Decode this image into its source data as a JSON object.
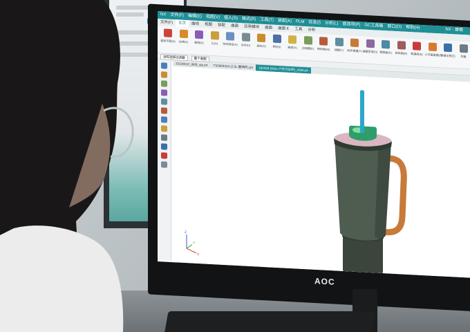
{
  "monitor": {
    "brand": "AOC"
  },
  "nx": {
    "titlebar": {
      "menu": [
        "NX",
        "文件(F)",
        "编辑(E)",
        "视图(V)",
        "插入(S)",
        "格式(R)",
        "工具(T)",
        "装配(A)",
        "PLM",
        "信息(I)",
        "分析(L)",
        "首选项(P)",
        "GC工具箱",
        "窗口(O)",
        "帮助(H)"
      ],
      "app_title": "NX - 建模"
    },
    "ribbon_tabs": [
      {
        "label": "文件(F)",
        "active": false
      },
      {
        "label": "主页",
        "active": true
      },
      {
        "label": "曲线",
        "active": false
      },
      {
        "label": "视图",
        "active": false
      },
      {
        "label": "装配",
        "active": false
      },
      {
        "label": "曲面",
        "active": false
      },
      {
        "label": "应用模块",
        "active": false
      },
      {
        "label": "曲面",
        "active": false
      },
      {
        "label": "曲面 E",
        "active": false
      },
      {
        "label": "工具",
        "active": false
      },
      {
        "label": "分析",
        "active": false
      }
    ],
    "ribbon_tools": [
      {
        "label": "基准平面(D)",
        "color": "#c9463b"
      },
      {
        "label": "拉伸(X)",
        "color": "#d98b2b"
      },
      {
        "label": "旋转(R)",
        "color": "#8a5cb8"
      },
      {
        "label": "孔(H)",
        "color": "#caa03a"
      },
      {
        "label": "阵列特征(A)",
        "color": "#6b8fc1"
      },
      {
        "label": "合并(U)",
        "color": "#7a8b95"
      },
      {
        "label": "减去(S)",
        "color": "#c98d2e"
      },
      {
        "label": "相交(I)",
        "color": "#4e6fa8"
      },
      {
        "label": "抽壳(H)",
        "color": "#d1b24a"
      },
      {
        "label": "边倒圆(E)",
        "color": "#7a9b5d"
      },
      {
        "label": "倒斜角(M)",
        "color": "#b85a3c"
      },
      {
        "label": "拔模(T)",
        "color": "#5e8e9e"
      },
      {
        "label": "同步建模(Y)",
        "color": "#c97a3a"
      },
      {
        "label": "偏置区域(O)",
        "color": "#8c6a9e"
      },
      {
        "label": "替换面(R)",
        "color": "#4d89a8"
      },
      {
        "label": "移除面(R)",
        "color": "#a05a5a"
      },
      {
        "label": "数据库(B)",
        "color": "#c93a3a"
      },
      {
        "label": "小平面建模(F)",
        "color": "#d97a2b"
      },
      {
        "label": "数据迁移(E)",
        "color": "#3a6fa8"
      },
      {
        "label": "测量",
        "color": "#6c7b84"
      }
    ],
    "filterbar": {
      "selection_filter": "没有选择过滤器",
      "scope": "整个装配"
    },
    "doc_tabs": [
      {
        "label": "20230510_运动_stp.prt",
        "active": false
      },
      {
        "label": "TS090032A (2.5L 握柄杯).prt",
        "active": false
      },
      {
        "label": "192328 (40oz 户外汽车杯)_ASM.prt",
        "active": true
      }
    ],
    "leftbar_icons": [
      "part-navigator-icon",
      "assembly-navigator-icon",
      "constraint-navigator-icon",
      "history-icon",
      "role-icon",
      "reuse-library-icon",
      "web-browser-icon",
      "palette-icon",
      "system-materials-icon",
      "process-studio-icon",
      "manufacturing-wizard-icon",
      "hd3d-icon"
    ]
  },
  "model": {
    "name": "tumbler-with-handle-and-straw",
    "colors": {
      "body": "#4f5c50",
      "body_dark": "#2f3a31",
      "handle": "#c87a3a",
      "lid": "#d9b6c2",
      "inner": "#2f9e6a",
      "inner_light": "#7fe0a0",
      "straw": "#2aa7c9",
      "base": "#3b453c"
    }
  },
  "axes": {
    "x": "X",
    "y": "Y",
    "z": "Z"
  }
}
